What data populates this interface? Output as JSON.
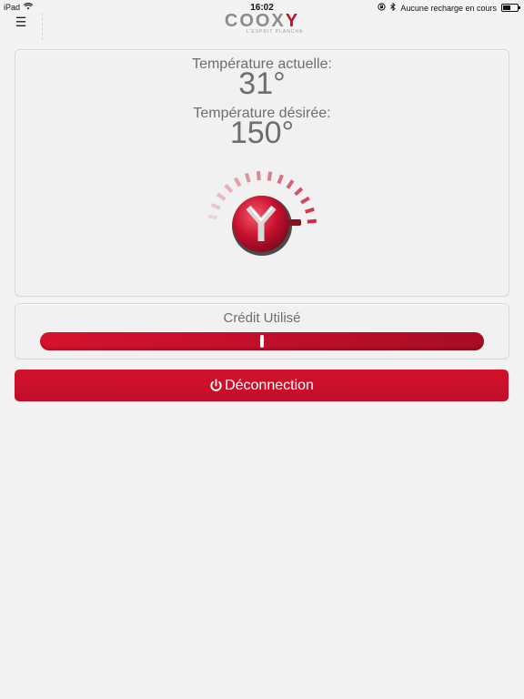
{
  "status_bar": {
    "device": "iPad",
    "time": "16:02",
    "charging_text": "Aucune recharge en cours",
    "battery_level": 0.55
  },
  "header": {
    "logo_text_a": "COOX",
    "logo_text_b": "Y",
    "logo_tagline": "L'ESPRIT PLANCHA",
    "menu_icon": "hamburger-icon"
  },
  "temperature": {
    "current_label": "Température actuelle:",
    "current_value": "31°",
    "desired_label": "Température désirée:",
    "desired_value": "150°",
    "dial_level": 0.5
  },
  "credit": {
    "label": "Crédit Utilisé",
    "level": 0.5
  },
  "logout": {
    "label": "Déconnection",
    "icon": "power-icon"
  },
  "colors": {
    "brand_red": "#c8102e",
    "background": "#f3f3f3"
  }
}
